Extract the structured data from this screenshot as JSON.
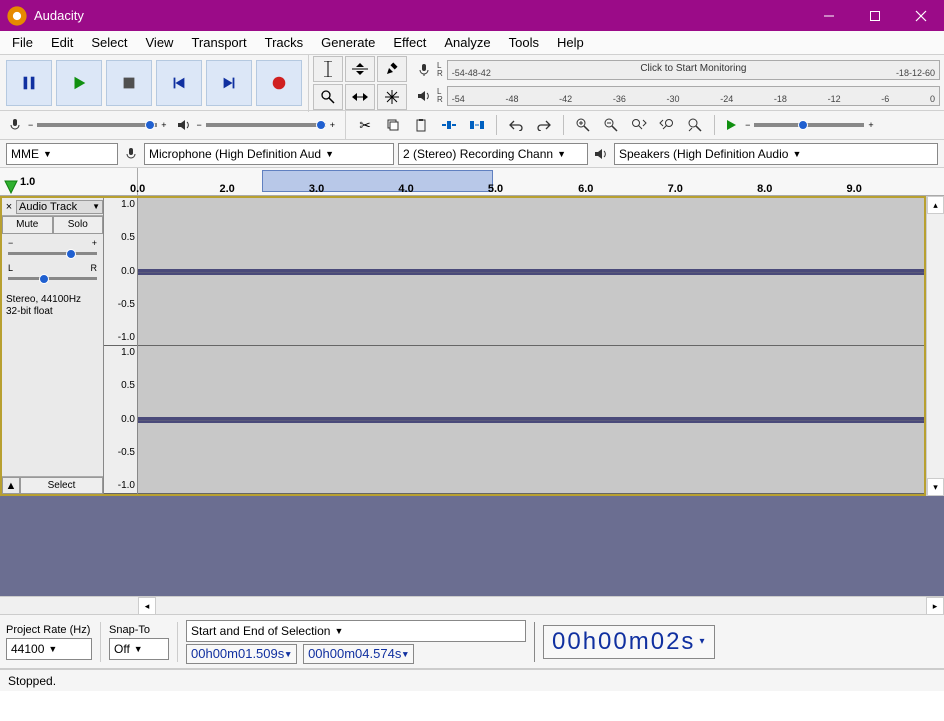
{
  "title": "Audacity",
  "menu": [
    "File",
    "Edit",
    "Select",
    "View",
    "Transport",
    "Tracks",
    "Generate",
    "Effect",
    "Analyze",
    "Tools",
    "Help"
  ],
  "meters": {
    "rec_text": "Click to Start Monitoring",
    "ticks": [
      "-54",
      "-48",
      "-42",
      "-36",
      "-30",
      "-24",
      "-18",
      "-12",
      "-6",
      "0"
    ],
    "ticks_rec_left": [
      "-54",
      "-48",
      "-42"
    ],
    "ticks_rec_right": [
      "-18",
      "-12",
      "-6",
      "0"
    ]
  },
  "devices": {
    "host": "MME",
    "rec_device": "Microphone (High Definition Aud",
    "rec_channels": "2 (Stereo) Recording Chann",
    "play_device": "Speakers (High Definition Audio"
  },
  "timeline": {
    "ticks": [
      "1.0",
      "2.0",
      "3.0",
      "4.0",
      "5.0",
      "6.0",
      "7.0",
      "8.0",
      "9.0"
    ],
    "extra_left": "0.0"
  },
  "track": {
    "title": "Audio Track",
    "mute": "Mute",
    "solo": "Solo",
    "pan_l": "L",
    "pan_r": "R",
    "format1": "Stereo, 44100Hz",
    "format2": "32-bit float",
    "select": "Select",
    "amp": [
      "1.0",
      "0.5",
      "0.0",
      "-0.5",
      "-1.0"
    ]
  },
  "bottom": {
    "project_rate_label": "Project Rate (Hz)",
    "project_rate": "44100",
    "snap_label": "Snap-To",
    "snap": "Off",
    "selection_label": "Start and End of Selection",
    "sel_start": "00h00m01.509s",
    "sel_end": "00h00m04.574s",
    "time": "00h00m02s"
  },
  "status": "Stopped."
}
